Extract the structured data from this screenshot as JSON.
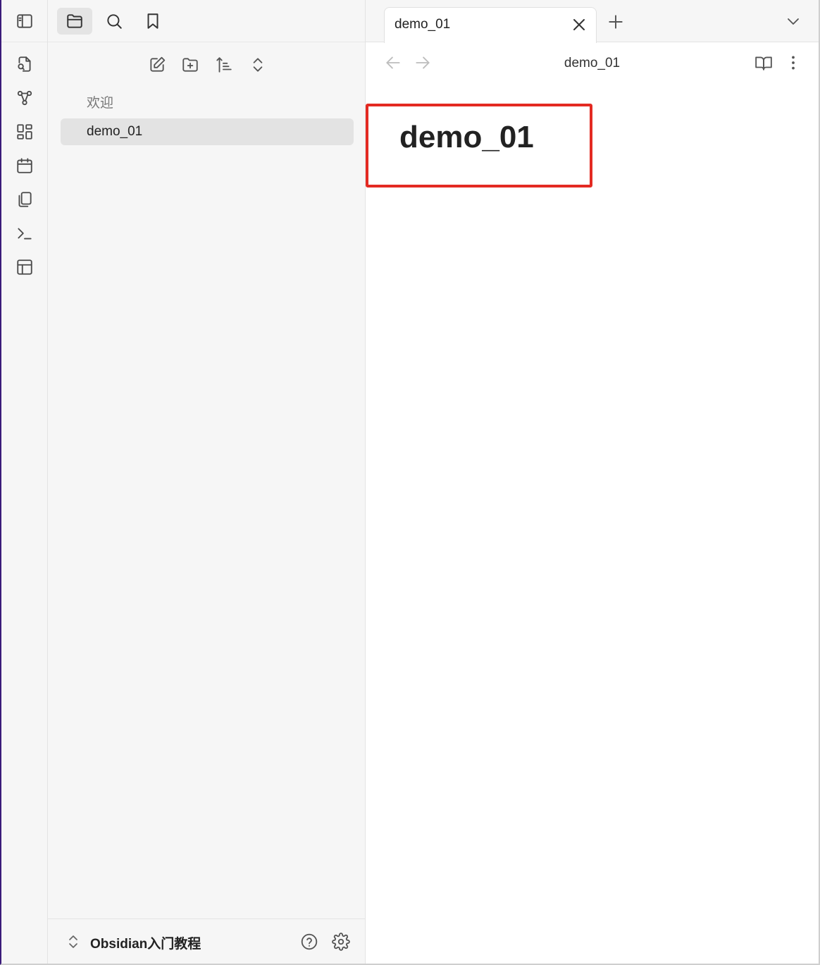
{
  "sidebar": {
    "tabs": [
      {
        "name": "files",
        "icon": "folder-icon"
      },
      {
        "name": "search",
        "icon": "search-icon"
      },
      {
        "name": "bookmarks",
        "icon": "bookmark-icon"
      }
    ],
    "files": [
      {
        "label": "欢迎",
        "active": false
      },
      {
        "label": "demo_01",
        "active": true
      }
    ],
    "vault_name": "Obsidian入门教程"
  },
  "ribbon": {
    "icons": [
      "open-quick-switcher-icon",
      "graph-view-icon",
      "canvas-icon",
      "daily-note-icon",
      "templates-icon",
      "command-palette-icon",
      "layout-icon"
    ]
  },
  "main": {
    "tab_title": "demo_01",
    "view_title": "demo_01",
    "document": {
      "title": "demo_01"
    }
  },
  "colors": {
    "highlight": "#e32a22",
    "sidebar_bg": "#f6f6f6",
    "active_item_bg": "#e3e3e3"
  }
}
